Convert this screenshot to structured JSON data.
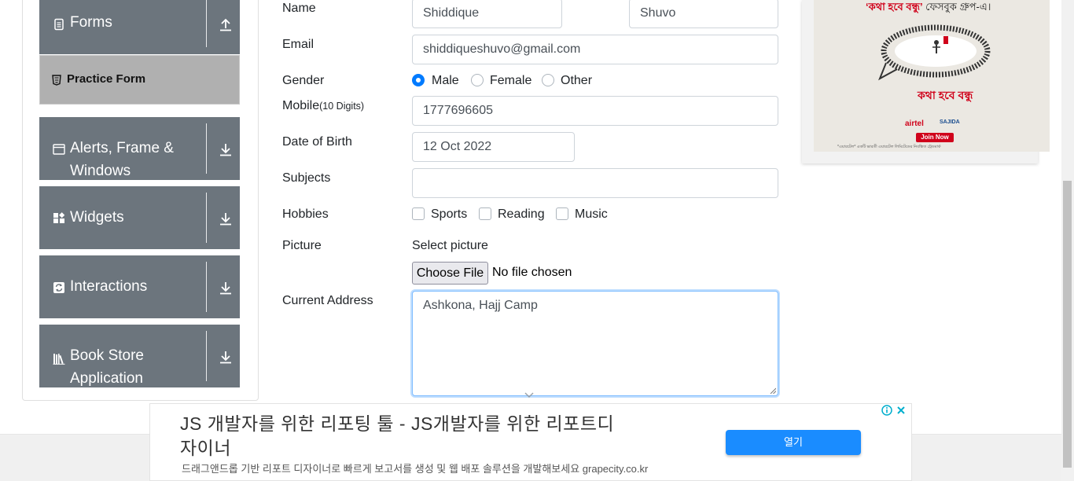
{
  "sidebar": {
    "groups": [
      {
        "label": "Forms",
        "icon": "document-icon",
        "arrow": "arrow-up-icon"
      },
      {
        "label": "Alerts, Frame & Windows",
        "icon": "window-icon",
        "arrow": "arrow-down-icon"
      },
      {
        "label": "Widgets",
        "icon": "widgets-icon",
        "arrow": "arrow-down-icon"
      },
      {
        "label": "Interactions",
        "icon": "interactions-icon",
        "arrow": "arrow-down-icon"
      },
      {
        "label": "Book Store Application",
        "icon": "books-icon",
        "arrow": "arrow-down-icon"
      }
    ],
    "active_item": {
      "label": "Practice Form",
      "icon": "html5-icon"
    }
  },
  "form": {
    "name_label": "Name",
    "first_name": "Shiddique",
    "last_name": "Shuvo",
    "email_label": "Email",
    "email": "shiddiqueshuvo@gmail.com",
    "gender_label": "Gender",
    "gender_options": [
      "Male",
      "Female",
      "Other"
    ],
    "gender_selected": "Male",
    "mobile_label": "Mobile",
    "mobile_hint": "(10 Digits)",
    "mobile": "1777696605",
    "dob_label": "Date of Birth",
    "dob": "12 Oct 2022",
    "subjects_label": "Subjects",
    "subjects_value": "",
    "hobbies_label": "Hobbies",
    "hobbies": [
      "Sports",
      "Reading",
      "Music"
    ],
    "picture_label": "Picture",
    "select_picture": "Select picture",
    "choose_file": "Choose File",
    "file_status": "No file chosen",
    "address_label": "Current Address",
    "address": "Ashkona, Hajj Camp"
  },
  "side_ad": {
    "headline_quote": "‘কথা হবে বন্ধু’",
    "headline_rest": " ফেসবুক গ্রুপ-এ।",
    "brand": "কথা হবে বন্ধু",
    "airtel": "airtel",
    "sajida": "SAJIDA",
    "join": "Join Now",
    "fine_print": "*এয়ারটেল* একটি ভারতী এয়ারটেল লিমিটেডের নিবন্ধিত ট্রেডমার্ক"
  },
  "bottom_ad": {
    "headline": "JS 개발자를 위한 리포팅 툴 - JS개발자를 위한 리포트디자이너",
    "description": "드래그앤드롭 기반 리포트 디자이너로 빠르게 보고서를 생성 및 웹 배포 솔루션을 개발해보세요 grapecity.co.kr",
    "open_button": "열기",
    "adchoices_icon": "info-icon",
    "close_icon": "close-icon"
  },
  "colors": {
    "sidebar_header": "#6c757d",
    "active_item": "#b0b0b0",
    "accent": "#007bff",
    "ad_button": "#1a8cff"
  }
}
